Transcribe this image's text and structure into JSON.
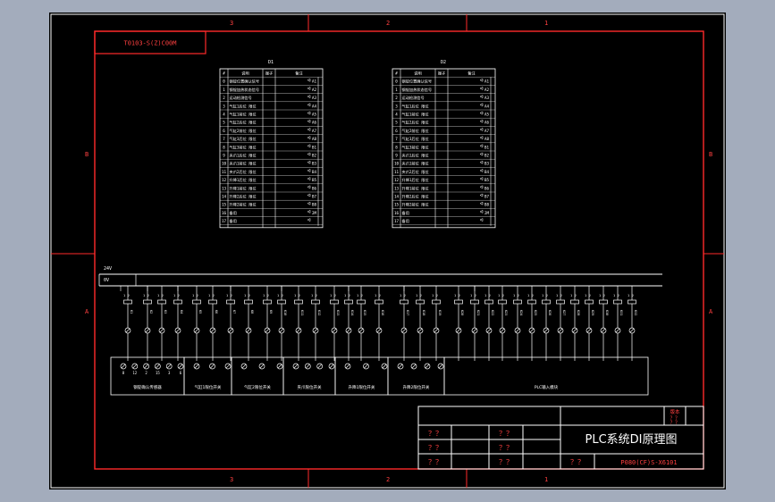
{
  "drawing": {
    "top_zones": [
      "3",
      "2",
      "1"
    ],
    "bottom_zones": [
      "3",
      "2",
      "1"
    ],
    "left_zones": [
      "B",
      "A"
    ],
    "right_zones": [
      "B",
      "A"
    ],
    "drawing_code": "T0103-S(Z)C00M"
  },
  "tables": [
    {
      "title": "D1",
      "headers": [
        "#",
        "说明",
        "端子",
        "备注"
      ],
      "rows": [
        [
          "0",
          "钢锭位置确认信号",
          "A1"
        ],
        [
          "1",
          "钢锭加热状态信号",
          "A2"
        ],
        [
          "2",
          "运动检测信号",
          "A3"
        ],
        [
          "3",
          "气缸1后位 限位",
          "A4"
        ],
        [
          "4",
          "气缸1前位 限位",
          "A5"
        ],
        [
          "5",
          "气缸2后位 限位",
          "A6"
        ],
        [
          "6",
          "气缸2前位 限位",
          "A7"
        ],
        [
          "7",
          "气缸3后位 限位",
          "A8"
        ],
        [
          "8",
          "气缸3前位 限位",
          "B1"
        ],
        [
          "9",
          "夹爪1后位 限位",
          "B2"
        ],
        [
          "10",
          "夹爪1前位 限位",
          "B3"
        ],
        [
          "11",
          "夹爪2后位 限位",
          "B4"
        ],
        [
          "12",
          "升降1后位 限位",
          "B5"
        ],
        [
          "13",
          "升降1前位 限位",
          "B6"
        ],
        [
          "14",
          "升降2后位 限位",
          "B7"
        ],
        [
          "15",
          "升降2前位 限位",
          "B8"
        ],
        [
          "16",
          "备用",
          "2M"
        ],
        [
          "17",
          "备用",
          ""
        ]
      ]
    },
    {
      "title": "D2",
      "headers": [
        "#",
        "说明",
        "端子",
        "备注"
      ],
      "rows": [
        [
          "0",
          "钢锭位置确认信号",
          "A1"
        ],
        [
          "1",
          "钢锭加热状态信号",
          "A2"
        ],
        [
          "2",
          "运动检测信号",
          "A3"
        ],
        [
          "3",
          "气缸1后位 限位",
          "A4"
        ],
        [
          "4",
          "气缸1前位 限位",
          "A5"
        ],
        [
          "5",
          "气缸2后位 限位",
          "A6"
        ],
        [
          "6",
          "气缸2前位 限位",
          "A7"
        ],
        [
          "7",
          "气缸3后位 限位",
          "A8"
        ],
        [
          "8",
          "气缸3前位 限位",
          "B1"
        ],
        [
          "9",
          "夹爪1后位 限位",
          "B2"
        ],
        [
          "10",
          "夹爪1前位 限位",
          "B3"
        ],
        [
          "11",
          "夹爪2后位 限位",
          "B4"
        ],
        [
          "12",
          "升降1后位 限位",
          "B5"
        ],
        [
          "13",
          "升降1前位 限位",
          "B6"
        ],
        [
          "14",
          "升降2后位 限位",
          "B7"
        ],
        [
          "15",
          "升降2前位 限位",
          "B8"
        ],
        [
          "16",
          "备用",
          "2M"
        ],
        [
          "17",
          "备用",
          ""
        ]
      ]
    }
  ],
  "bus": {
    "supply_label": "24V",
    "zero_label": "0V"
  },
  "relays": {
    "contact_label": "1 2",
    "group1": [
      "K1",
      "K2",
      "K3",
      "K4"
    ],
    "group2": [
      "K5",
      "K6",
      "K7",
      "K8",
      "K9",
      "K10"
    ],
    "group3": [
      "K11",
      "K12",
      "K13",
      "K14",
      "K15",
      "K16",
      "K17",
      "K18",
      "K19",
      "K20",
      "K21",
      "K22",
      "K23",
      "K24",
      "K25",
      "K26",
      "K27",
      "K28",
      "K29",
      "K30",
      "K31",
      "K32",
      "K33",
      "K34"
    ]
  },
  "terminal_numbers": [
    "8",
    "12",
    "2",
    "15",
    "3",
    "6"
  ],
  "device_groups": [
    "钢锭确认传感器",
    "气缸1限位开关",
    "气缸2限位开关",
    "夹爪限位开关",
    "升降1限位开关",
    "升降2限位开关",
    "PLC输入模块"
  ],
  "title_block": {
    "title": "PLC系统DI原理图",
    "drawing_no": "P080(CF)S-X6101",
    "placeholder": "？？",
    "corner_labels": [
      "版本",
      "？？",
      "？？"
    ]
  }
}
